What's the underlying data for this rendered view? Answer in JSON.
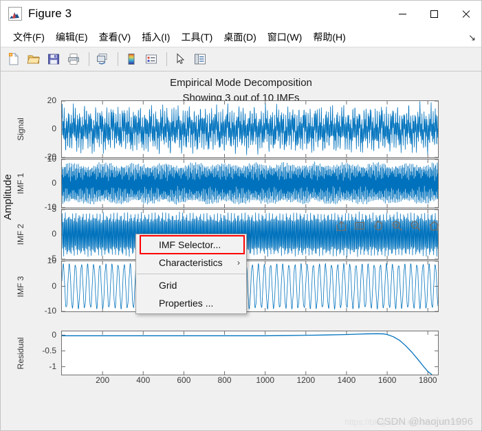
{
  "window": {
    "title": "Figure 3",
    "app_icon": "matlab-figure-icon",
    "minimize_label": "—",
    "maximize_label": "□",
    "close_label": "✕"
  },
  "menubar": {
    "items": [
      {
        "label": "文件(F)",
        "name": "menu-file"
      },
      {
        "label": "编辑(E)",
        "name": "menu-edit"
      },
      {
        "label": "查看(V)",
        "name": "menu-view"
      },
      {
        "label": "插入(I)",
        "name": "menu-insert"
      },
      {
        "label": "工具(T)",
        "name": "menu-tools"
      },
      {
        "label": "桌面(D)",
        "name": "menu-desktop"
      },
      {
        "label": "窗口(W)",
        "name": "menu-window"
      },
      {
        "label": "帮助(H)",
        "name": "menu-help"
      }
    ],
    "expander": "↘"
  },
  "toolbar": {
    "buttons": [
      {
        "name": "new-figure-icon",
        "tooltip": "New Figure"
      },
      {
        "name": "open-file-icon",
        "tooltip": "Open File"
      },
      {
        "name": "save-figure-icon",
        "tooltip": "Save Figure"
      },
      {
        "name": "print-figure-icon",
        "tooltip": "Print Figure"
      },
      {
        "name": "link-plot-icon",
        "tooltip": "Link Plot"
      },
      {
        "name": "colorbar-icon",
        "tooltip": "Insert Colorbar"
      },
      {
        "name": "legend-icon",
        "tooltip": "Insert Legend"
      },
      {
        "name": "edit-plot-pointer-icon",
        "tooltip": "Edit Plot"
      },
      {
        "name": "plot-browser-icon",
        "tooltip": "Show Plot Tools"
      }
    ]
  },
  "figure": {
    "title": "Empirical Mode Decomposition",
    "subtitle": "Showing 3 out of 10 IMFs",
    "ylabel": "Amplitude"
  },
  "axes_toolbar": {
    "buttons": [
      {
        "name": "export-icon",
        "tooltip": "Export"
      },
      {
        "name": "datatip-icon",
        "tooltip": "Data Tips"
      },
      {
        "name": "pan-hand-icon",
        "tooltip": "Pan"
      },
      {
        "name": "zoom-in-icon",
        "tooltip": "Zoom In"
      },
      {
        "name": "zoom-out-icon",
        "tooltip": "Zoom Out"
      },
      {
        "name": "restore-home-icon",
        "tooltip": "Restore View"
      }
    ]
  },
  "context_menu": {
    "items": [
      {
        "label": "IMF Selector...",
        "name": "ctx-imf-selector",
        "highlighted": true,
        "submenu": false
      },
      {
        "label": "Characteristics",
        "name": "ctx-characteristics",
        "highlighted": false,
        "submenu": true,
        "arrow": "›"
      },
      {
        "separator": true
      },
      {
        "label": "Grid",
        "name": "ctx-grid",
        "highlighted": false,
        "submenu": false
      },
      {
        "label": "Properties ...",
        "name": "ctx-properties",
        "highlighted": false,
        "submenu": false
      }
    ]
  },
  "watermark": {
    "text": "CSDN @haojun1996",
    "url": "https://blog.csdn.net/haojun1996"
  },
  "colors": {
    "line": "#0072BD",
    "axes_border": "#6f6f6f",
    "figure_bg": "#f0f0f0",
    "axes_bg": "#ffffff",
    "highlight": "#ff0000",
    "text": "#1a1a1a",
    "tick_text": "#3a3a3a"
  },
  "chart_data": {
    "type": "line",
    "title": "Empirical Mode Decomposition",
    "subtitle": "Showing 3 out of 10 IMFs",
    "xlabel": "",
    "ylabel": "Amplitude",
    "xlim": [
      0,
      1850
    ],
    "xticks": [
      200,
      400,
      600,
      800,
      1000,
      1200,
      1400,
      1600,
      1800
    ],
    "grid": false,
    "legend": "none",
    "panels": [
      {
        "name": "Signal",
        "ylabel": "Signal",
        "ylim": [
          -20,
          20
        ],
        "yticks": [
          20,
          0,
          -20
        ],
        "description": "Dense multi-component oscillation filling the band, amplitude envelope roughly +/-16 with a lower-frequency beat, plus a high-frequency carrier.",
        "synth": {
          "components": [
            {
              "amp": 9.0,
              "period": 5.0,
              "phase": 0.0
            },
            {
              "amp": 5.5,
              "period": 11.0,
              "phase": 1.1
            },
            {
              "amp": 3.0,
              "period": 27.0,
              "phase": 0.4
            },
            {
              "amp": 2.0,
              "period": 63.0,
              "phase": 2.0
            }
          ],
          "noise": 1.2
        }
      },
      {
        "name": "IMF 1",
        "ylabel": "IMF 1",
        "ylim": [
          -10,
          10
        ],
        "yticks": [
          10,
          0,
          -10
        ],
        "description": "Highest-frequency mode, a solid saturated band of roughly constant amplitude +/-8 with ragged edges.",
        "synth": {
          "components": [
            {
              "amp": 7.6,
              "period": 2.6,
              "phase": 0.0
            },
            {
              "amp": 0.8,
              "period": 9.0,
              "phase": 0.7
            }
          ],
          "noise": 0.9
        }
      },
      {
        "name": "IMF 2",
        "ylabel": "IMF 2",
        "ylim": [
          -5,
          5
        ],
        "yticks": [
          5,
          0,
          -5
        ],
        "description": "Mid-frequency mode, amplitude about +/-4 with visible individual cycles and slight envelope modulation.",
        "synth": {
          "components": [
            {
              "amp": 3.6,
              "period": 5.2,
              "phase": 0.3
            },
            {
              "amp": 0.7,
              "period": 17.0,
              "phase": 1.5
            }
          ],
          "noise": 0.35
        }
      },
      {
        "name": "IMF 3",
        "ylabel": "IMF 3",
        "ylim": [
          -10,
          10
        ],
        "yticks": [
          10,
          0,
          -10
        ],
        "description": "Low-frequency mode with clearly resolved cycles, amplitude near +/-9, about 60 cycles across the record.",
        "synth": {
          "components": [
            {
              "amp": 8.6,
              "period": 30.0,
              "phase": 0.2
            },
            {
              "amp": 0.5,
              "period": 7.0,
              "phase": 0.9
            }
          ],
          "noise": 0.15
        }
      },
      {
        "name": "Residual",
        "ylabel": "Residual",
        "ylim": [
          -1.25,
          0.12
        ],
        "yticks": [
          0,
          -0.5,
          -1
        ],
        "description": "Smooth monotone trend: flat near 0 until about x=1450, small rise to a peak near x=1560, then a steep fall to about -1.15 at x=1800.",
        "points": [
          [
            0,
            -0.02
          ],
          [
            100,
            -0.02
          ],
          [
            200,
            -0.02
          ],
          [
            300,
            -0.02
          ],
          [
            400,
            -0.02
          ],
          [
            500,
            -0.02
          ],
          [
            600,
            -0.02
          ],
          [
            700,
            -0.02
          ],
          [
            800,
            -0.02
          ],
          [
            900,
            -0.02
          ],
          [
            1000,
            -0.02
          ],
          [
            1100,
            -0.015
          ],
          [
            1200,
            -0.005
          ],
          [
            1300,
            0.005
          ],
          [
            1400,
            0.02
          ],
          [
            1450,
            0.03
          ],
          [
            1500,
            0.04
          ],
          [
            1550,
            0.045
          ],
          [
            1580,
            0.04
          ],
          [
            1600,
            0.02
          ],
          [
            1630,
            -0.05
          ],
          [
            1660,
            -0.16
          ],
          [
            1690,
            -0.33
          ],
          [
            1720,
            -0.53
          ],
          [
            1750,
            -0.76
          ],
          [
            1780,
            -1.0
          ],
          [
            1800,
            -1.15
          ],
          [
            1820,
            -1.25
          ]
        ]
      }
    ]
  }
}
